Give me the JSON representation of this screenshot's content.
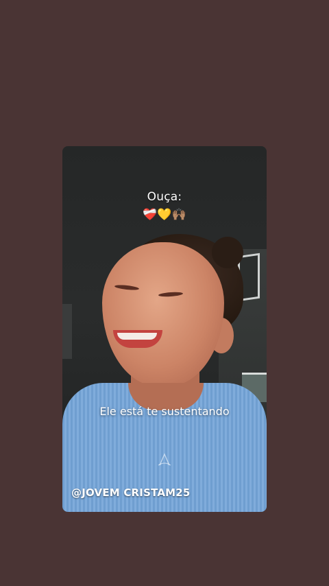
{
  "story": {
    "title": "Ouça:",
    "emojis": "❤️‍🩹💛🙌🏽",
    "caption": "Ele está te sustentando",
    "watermark_text": "",
    "handle": "@JOVEM CRISTAM25"
  },
  "icons": {
    "watermark": "watermark-logo-icon"
  },
  "colors": {
    "background": "#4a3434",
    "shirt": "#77a5d6",
    "text": "#ffffff"
  }
}
